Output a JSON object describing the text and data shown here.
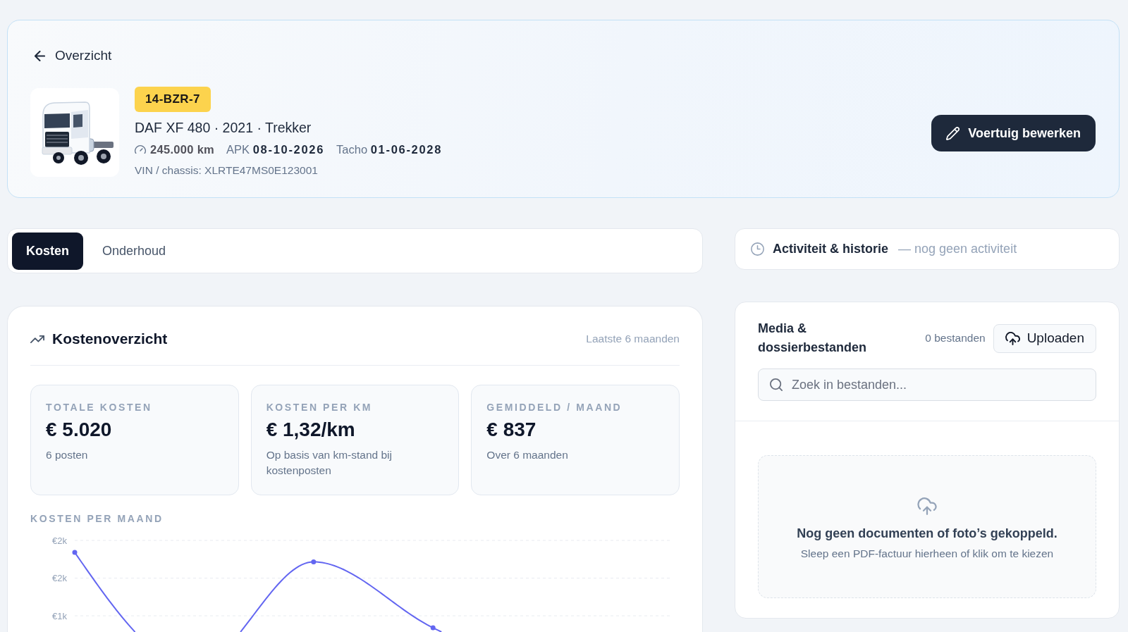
{
  "back_link": {
    "label": "Overzicht"
  },
  "vehicle": {
    "plate": "14-BZR-7",
    "title": "DAF XF 480 · 2021 · Trekker",
    "odometer": "245.000 km",
    "apk": "APK **08-10-2026**",
    "tacho": "Tacho **01-06-2028**",
    "vin": "VIN / chassis: XLRTE47MS0E123001"
  },
  "edit_button": {
    "label": "Voertuig bewerken"
  },
  "tabs": [
    {
      "label": "Kosten",
      "selected": true
    },
    {
      "label": "Onderhoud",
      "selected": false
    }
  ],
  "activity": {
    "title": "Activiteit & historie",
    "note": "— nog geen activiteit"
  },
  "cost_overview": {
    "title": "Kostenoverzicht",
    "period": "Laatste 6 maanden",
    "stats": [
      {
        "label": "TOTALE KOSTEN",
        "value": "€ 5.020",
        "note": "6 posten"
      },
      {
        "label": "KOSTEN PER KM",
        "value": "€ 1,32/km",
        "note": "Op basis van km-stand bij kostenposten"
      },
      {
        "label": "GEMIDDELD / MAAND",
        "value": "€ 837",
        "note": "Over 6 maanden"
      }
    ],
    "chart": {
      "title": "KOSTEN PER MAAND",
      "y_labels": [
        "€2k",
        "€2k",
        "€1k"
      ]
    }
  },
  "media": {
    "title": "Media & dossierbestanden",
    "count": "0 bestanden",
    "upload_button": "Uploaden",
    "search": {
      "placeholder": "Zoek in bestanden..."
    },
    "empty_state": {
      "title": "Nog geen documenten of foto’s gekoppeld.",
      "hint": "Sleep een PDF-factuur hierheen of klik om te kiezen"
    }
  }
}
